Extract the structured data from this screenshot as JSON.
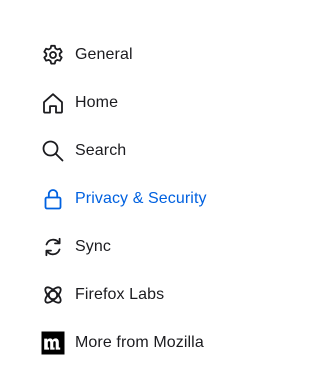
{
  "sidebar": {
    "accent_color": "#0061e0",
    "text_color": "#1b1b1f",
    "items": [
      {
        "label": "General",
        "icon": "gear-icon",
        "active": false
      },
      {
        "label": "Home",
        "icon": "home-icon",
        "active": false
      },
      {
        "label": "Search",
        "icon": "search-icon",
        "active": false
      },
      {
        "label": "Privacy & Security",
        "icon": "lock-icon",
        "active": true
      },
      {
        "label": "Sync",
        "icon": "sync-icon",
        "active": false
      },
      {
        "label": "Firefox Labs",
        "icon": "labs-atom-icon",
        "active": false
      },
      {
        "label": "More from Mozilla",
        "icon": "mozilla-logo-icon",
        "active": false
      }
    ]
  }
}
